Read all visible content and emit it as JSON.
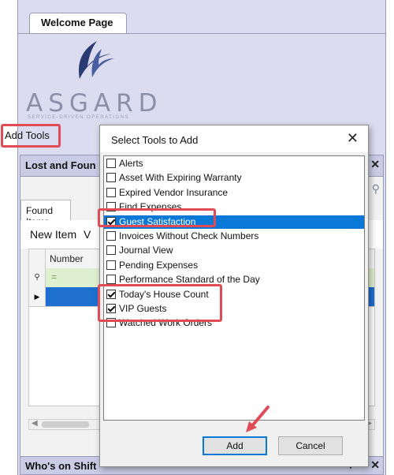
{
  "tabs": [
    {
      "label": "Welcome Page"
    }
  ],
  "logo": {
    "name": "ASGARD",
    "tagline": "SERVICE-DRIVEN OPERATIONS"
  },
  "add_tools_label": "Add Tools",
  "lost_found": {
    "title": "Lost and Foun",
    "tab": "Found Items",
    "new_item": "New Item",
    "toolbar_partial": "V",
    "column": "Number",
    "filter_symbol": "="
  },
  "whos_on_shift": {
    "title": "Who's on Shift",
    "controls": "▾ — ✕"
  },
  "dialog": {
    "title": "Select Tools to Add",
    "close": "✕",
    "items": [
      {
        "label": "Alerts",
        "checked": false,
        "selected": false
      },
      {
        "label": "Asset With Expiring Warranty",
        "checked": false,
        "selected": false
      },
      {
        "label": "Expired Vendor Insurance",
        "checked": false,
        "selected": false
      },
      {
        "label": "Find Expenses",
        "checked": false,
        "selected": false
      },
      {
        "label": "Guest Satisfaction",
        "checked": true,
        "selected": true
      },
      {
        "label": "Invoices Without Check Numbers",
        "checked": false,
        "selected": false
      },
      {
        "label": "Journal View",
        "checked": false,
        "selected": false
      },
      {
        "label": "Pending Expenses",
        "checked": false,
        "selected": false
      },
      {
        "label": "Performance Standard of the Day",
        "checked": false,
        "selected": false
      },
      {
        "label": "Today's House Count",
        "checked": true,
        "selected": false
      },
      {
        "label": "VIP Guests",
        "checked": true,
        "selected": false
      },
      {
        "label": "Watched Work Orders",
        "checked": false,
        "selected": false
      }
    ],
    "add_label": "Add",
    "cancel_label": "Cancel"
  },
  "colors": {
    "highlight": "#e14b55",
    "selection": "#0a78d7",
    "header": "#c9cce4"
  }
}
